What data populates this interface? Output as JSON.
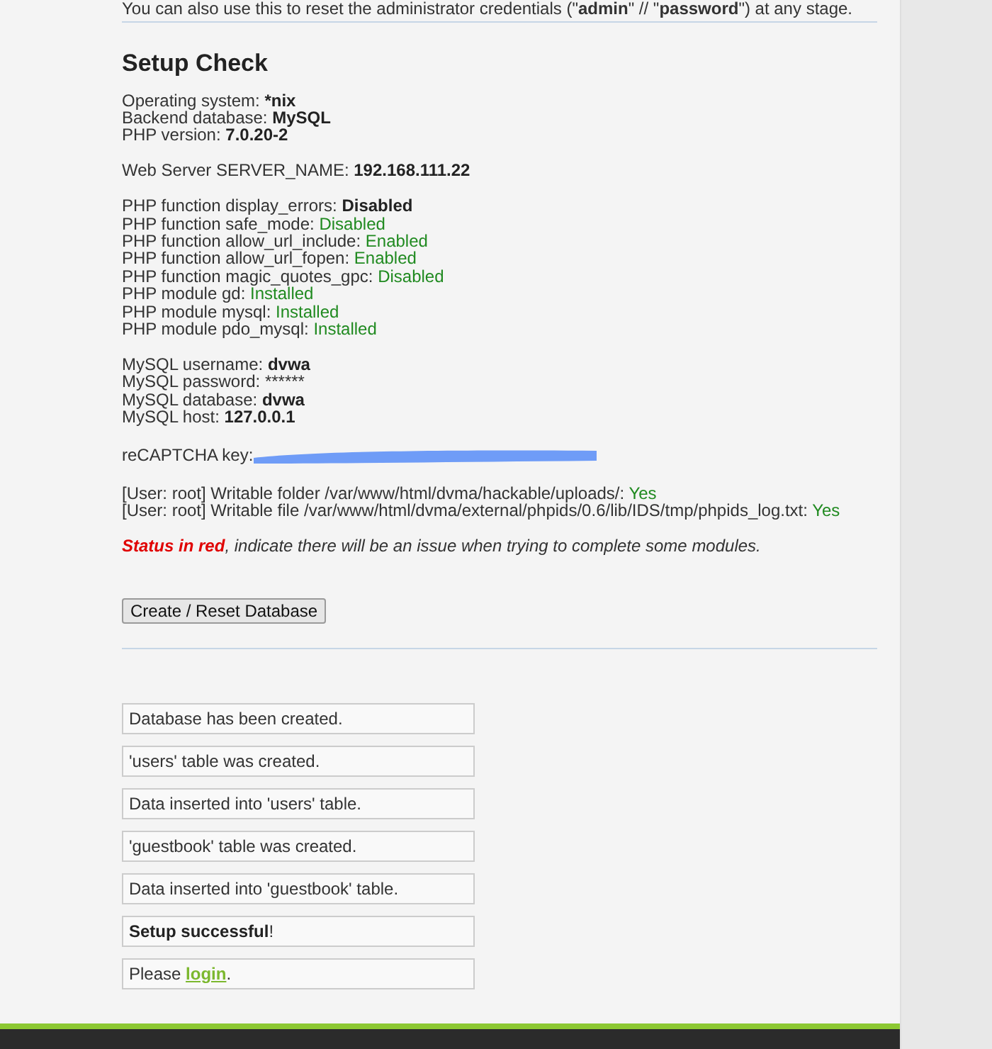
{
  "intro": {
    "text": "You can also use this to reset the administrator credentials (\"**admin**\" // \"**password**\") at any stage."
  },
  "heading": "Setup Check",
  "groups": [
    {
      "lines": [
        {
          "label": "Operating system:",
          "value": "*nix",
          "kind": "bold"
        },
        {
          "label": "Backend database:",
          "value": "MySQL",
          "kind": "bold"
        },
        {
          "label": "PHP version:",
          "value": "7.0.20-2",
          "kind": "bold"
        }
      ]
    },
    {
      "lines": [
        {
          "label": "Web Server SERVER_NAME:",
          "value": "192.168.111.22",
          "kind": "bold"
        }
      ]
    },
    {
      "lines": [
        {
          "label": "PHP function display_errors:",
          "value": "Disabled",
          "kind": "bold"
        },
        {
          "label": "PHP function safe_mode:",
          "value": "Disabled",
          "kind": "ok"
        },
        {
          "label": "PHP function allow_url_include:",
          "value": "Enabled",
          "kind": "ok"
        },
        {
          "label": "PHP function allow_url_fopen:",
          "value": "Enabled",
          "kind": "ok"
        },
        {
          "label": "PHP function magic_quotes_gpc:",
          "value": "Disabled",
          "kind": "ok"
        },
        {
          "label": "PHP module gd:",
          "value": "Installed",
          "kind": "ok"
        },
        {
          "label": "PHP module mysql:",
          "value": "Installed",
          "kind": "ok"
        },
        {
          "label": "PHP module pdo_mysql:",
          "value": "Installed",
          "kind": "ok"
        }
      ]
    },
    {
      "lines": [
        {
          "label": "MySQL username:",
          "value": "dvwa",
          "kind": "bold"
        },
        {
          "label": "MySQL password:",
          "value": "******",
          "kind": "plain"
        },
        {
          "label": "MySQL database:",
          "value": "dvwa",
          "kind": "bold"
        },
        {
          "label": "MySQL host:",
          "value": "127.0.0.1",
          "kind": "bold"
        }
      ]
    },
    {
      "lines": [
        {
          "label": "reCAPTCHA key:",
          "kind": "redacted"
        }
      ]
    },
    {
      "lines": [
        {
          "label": "[User: root] Writable folder /var/www/html/dvma/hackable/uploads/:",
          "value": "Yes",
          "kind": "ok"
        },
        {
          "label": "[User: root] Writable file /var/www/html/dvma/external/phpids/0.6/lib/IDS/tmp/phpids_log.txt:",
          "value": "Yes",
          "kind": "ok"
        }
      ]
    }
  ],
  "legend": {
    "status": "Status in red",
    "rest": ", indicate there will be an issue when trying to complete some modules."
  },
  "button": "Create / Reset Database",
  "messages": [
    {
      "text": "Database has been created.",
      "kind": "plain"
    },
    {
      "text": "'users' table was created.",
      "kind": "plain"
    },
    {
      "text": "Data inserted into 'users' table.",
      "kind": "plain"
    },
    {
      "text": "'guestbook' table was created.",
      "kind": "plain"
    },
    {
      "text": "Data inserted into 'guestbook' table.",
      "kind": "plain"
    },
    {
      "text": "Setup successful",
      "suffix": "!",
      "kind": "bold"
    },
    {
      "text": "Please ",
      "link": "login",
      "suffix": ".",
      "kind": "link"
    }
  ]
}
